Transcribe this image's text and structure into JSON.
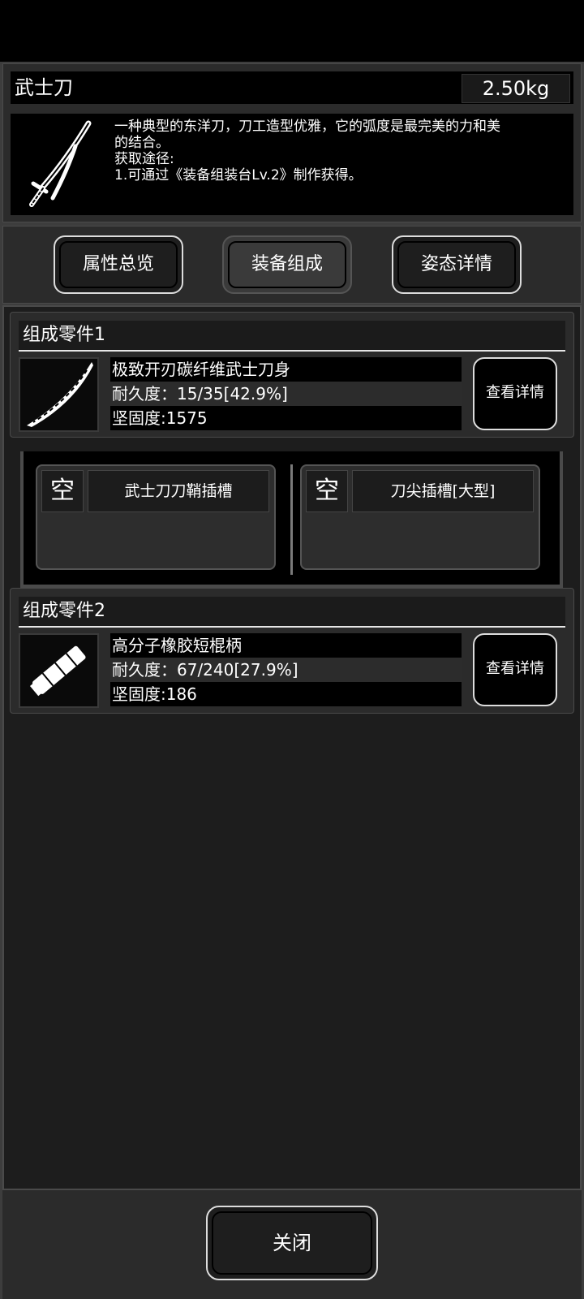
{
  "item": {
    "name": "武士刀",
    "weight": "2.50kg",
    "icon": "katana-icon",
    "description_lines": [
      "一种典型的东洋刀，刀工造型优雅，它的弧度是最完美的力和美",
      "的结合。",
      "获取途径:",
      "1.可通过《装备组装台Lv.2》制作获得。"
    ]
  },
  "tabs": [
    {
      "label": "属性总览",
      "active": false
    },
    {
      "label": "装备组成",
      "active": true
    },
    {
      "label": "姿态详情",
      "active": false
    }
  ],
  "parts": [
    {
      "header": "组成零件1",
      "name": "极致开刃碳纤维武士刀身",
      "durability": "耐久度：15/35[42.9%]",
      "hardness": "坚固度:1575",
      "icon": "blade-icon",
      "detail_label": "查看详情"
    },
    {
      "header": "组成零件2",
      "name": "高分子橡胶短棍柄",
      "durability": "耐久度：67/240[27.9%]",
      "hardness": "坚固度:186",
      "icon": "handle-icon",
      "detail_label": "查看详情"
    }
  ],
  "sockets": [
    {
      "state": "空",
      "name": "武士刀刀鞘插槽"
    },
    {
      "state": "空",
      "name": "刀尖插槽[大型]"
    }
  ],
  "close_label": "关闭"
}
